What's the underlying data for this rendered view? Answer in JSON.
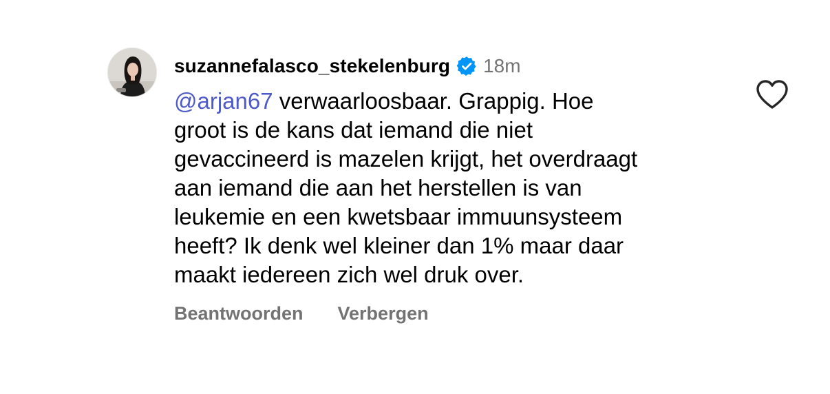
{
  "comment": {
    "username": "suzannefalasco_stekelenburg",
    "verified": true,
    "verified_icon": "verified-badge-icon",
    "timestamp": "18m",
    "mention": "@arjan67",
    "text": " verwaarloosbaar. Grappig. Hoe\ngroot is de kans dat iemand die niet\ngevaccineerd is mazelen krijgt, het overdraagt\naan iemand die aan het herstellen is van\nleukemie en een kwetsbaar immuunsysteem\nheeft? Ik denk wel kleiner dan 1% maar daar\nmaakt iedereen zich wel druk over.",
    "actions": {
      "reply_label": "Beantwoorden",
      "hide_label": "Verbergen"
    },
    "like_icon": "heart-outline-icon",
    "avatar_icon": "profile-photo"
  },
  "colors": {
    "mention": "#4d5ac8",
    "secondary_text": "#737373",
    "verified_blue": "#0095f6"
  }
}
